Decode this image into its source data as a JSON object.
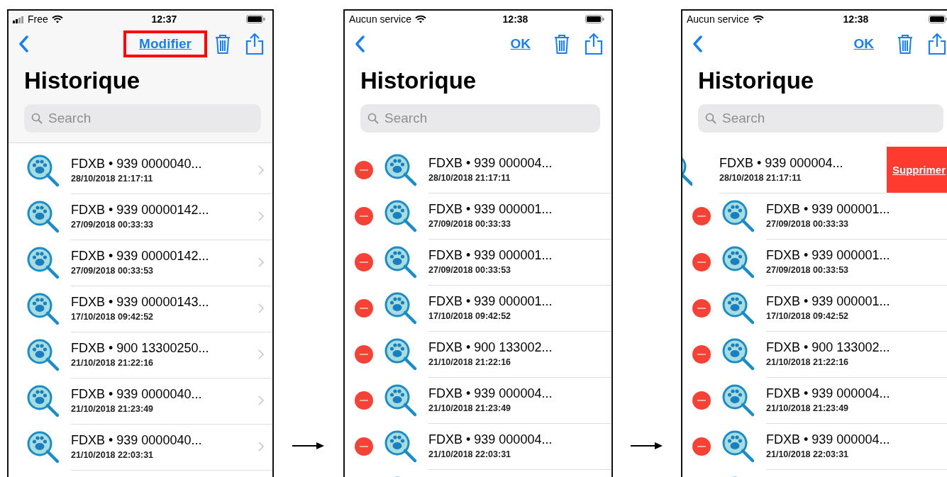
{
  "screens": [
    {
      "status_bar": {
        "carrier": "Free",
        "time": "12:37",
        "has_signal": true
      },
      "nav": {
        "edit_label": "Modifier",
        "highlighted": true
      },
      "title": "Historique",
      "search": {
        "placeholder": "Search"
      },
      "editing": false,
      "rows": [
        {
          "kind": "normal",
          "title": "FDXB • 939 0000040...",
          "date": "28/10/2018 21:17:11"
        },
        {
          "kind": "normal",
          "title": "FDXB • 939 00000142...",
          "date": "27/09/2018 00:33:33"
        },
        {
          "kind": "normal",
          "title": "FDXB • 939 00000142...",
          "date": "27/09/2018 00:33:53"
        },
        {
          "kind": "normal",
          "title": "FDXB • 939 00000143...",
          "date": "17/10/2018 09:42:52"
        },
        {
          "kind": "normal",
          "title": "FDXB • 900 13300250...",
          "date": "21/10/2018 21:22:16"
        },
        {
          "kind": "normal",
          "title": "FDXB • 939 0000040...",
          "date": "21/10/2018 21:23:49"
        },
        {
          "kind": "normal",
          "title": "FDXB • 939 0000040...",
          "date": "21/10/2018 22:03:31"
        }
      ]
    },
    {
      "status_bar": {
        "carrier": "Aucun service",
        "time": "12:38",
        "has_signal": false
      },
      "nav": {
        "edit_label": "OK",
        "highlighted": false
      },
      "title": "Historique",
      "search": {
        "placeholder": "Search"
      },
      "editing": true,
      "rows": [
        {
          "kind": "normal",
          "title": "FDXB • 939 000004...",
          "date": "28/10/2018 21:17:11"
        },
        {
          "kind": "normal",
          "title": "FDXB • 939 000001...",
          "date": "27/09/2018 00:33:33"
        },
        {
          "kind": "normal",
          "title": "FDXB • 939 000001...",
          "date": "27/09/2018 00:33:53"
        },
        {
          "kind": "normal",
          "title": "FDXB • 939 000001...",
          "date": "17/10/2018 09:42:52"
        },
        {
          "kind": "normal",
          "title": "FDXB • 900 133002...",
          "date": "21/10/2018 21:22:16"
        },
        {
          "kind": "normal",
          "title": "FDXB • 939 000004...",
          "date": "21/10/2018 21:23:49"
        },
        {
          "kind": "normal",
          "title": "FDXB • 939 000004...",
          "date": "21/10/2018 22:03:31"
        }
      ]
    },
    {
      "status_bar": {
        "carrier": "Aucun service",
        "time": "12:38",
        "has_signal": false
      },
      "nav": {
        "edit_label": "OK",
        "highlighted": false
      },
      "title": "Historique",
      "search": {
        "placeholder": "Search"
      },
      "editing": true,
      "rows": [
        {
          "kind": "swiped",
          "title": "FDXB • 939 000004...",
          "date": "28/10/2018 21:17:11",
          "action": "Supprimer"
        },
        {
          "kind": "normal",
          "title": "FDXB • 939 000001...",
          "date": "27/09/2018 00:33:33"
        },
        {
          "kind": "normal",
          "title": "FDXB • 939 000001...",
          "date": "27/09/2018 00:33:53"
        },
        {
          "kind": "normal",
          "title": "FDXB • 939 000001...",
          "date": "17/10/2018 09:42:52"
        },
        {
          "kind": "normal",
          "title": "FDXB • 900 133002...",
          "date": "21/10/2018 21:22:16"
        },
        {
          "kind": "normal",
          "title": "FDXB • 939 000004...",
          "date": "21/10/2018 21:23:49"
        },
        {
          "kind": "normal",
          "title": "FDXB • 939 000004...",
          "date": "21/10/2018 22:03:31"
        }
      ]
    }
  ]
}
